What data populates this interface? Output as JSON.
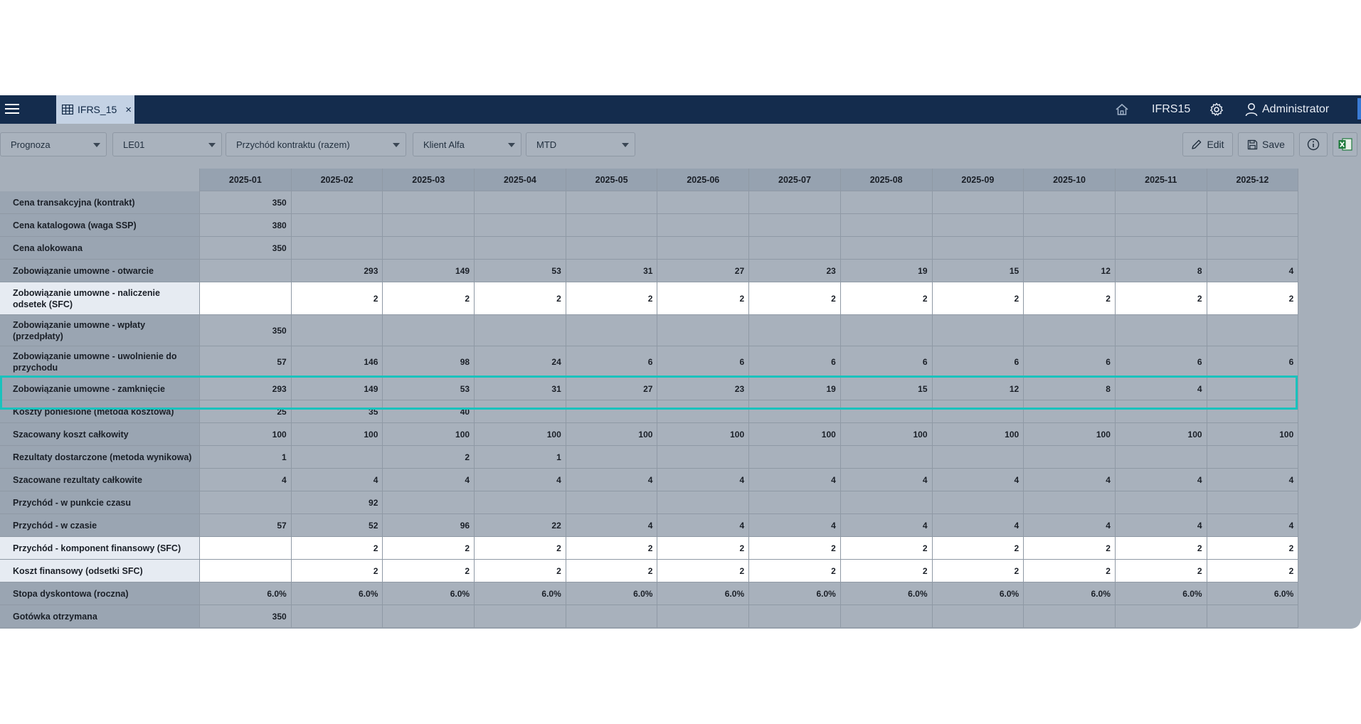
{
  "topbar": {
    "tab_label": "IFRS_15",
    "tab_close": "×",
    "home_icon": "home-icon",
    "module_label": "IFRS15",
    "user_label": "Administrator"
  },
  "filters": [
    {
      "value": "Prognoza"
    },
    {
      "value": "LE01"
    },
    {
      "value": "Przychód kontraktu (razem)"
    },
    {
      "value": "Klient Alfa"
    },
    {
      "value": "MTD"
    }
  ],
  "toolbar": {
    "edit_label": "Edit",
    "save_label": "Save"
  },
  "grid": {
    "columns": [
      "2025-01",
      "2025-02",
      "2025-03",
      "2025-04",
      "2025-05",
      "2025-06",
      "2025-07",
      "2025-08",
      "2025-09",
      "2025-10",
      "2025-11",
      "2025-12"
    ],
    "rows": [
      {
        "label": "Cena transakcyjna (kontrakt)",
        "values": [
          "350",
          "",
          "",
          "",
          "",
          "",
          "",
          "",
          "",
          "",
          "",
          ""
        ]
      },
      {
        "label": "Cena katalogowa (waga SSP)",
        "values": [
          "380",
          "",
          "",
          "",
          "",
          "",
          "",
          "",
          "",
          "",
          "",
          ""
        ]
      },
      {
        "label": "Cena alokowana",
        "values": [
          "350",
          "",
          "",
          "",
          "",
          "",
          "",
          "",
          "",
          "",
          "",
          ""
        ]
      },
      {
        "label": "Zobowiązanie umowne - otwarcie",
        "values": [
          "",
          "293",
          "149",
          "53",
          "31",
          "27",
          "23",
          "19",
          "15",
          "12",
          "8",
          "4"
        ]
      },
      {
        "label": "Zobowiązanie umowne - naliczenie odsetek (SFC)",
        "values": [
          "",
          "2",
          "2",
          "2",
          "2",
          "2",
          "2",
          "2",
          "2",
          "2",
          "2",
          "2"
        ]
      },
      {
        "label": "Zobowiązanie umowne - wpłaty (przedpłaty)",
        "values": [
          "350",
          "",
          "",
          "",
          "",
          "",
          "",
          "",
          "",
          "",
          "",
          ""
        ]
      },
      {
        "label": "Zobowiązanie umowne - uwolnienie do przychodu",
        "values": [
          "57",
          "146",
          "98",
          "24",
          "6",
          "6",
          "6",
          "6",
          "6",
          "6",
          "6",
          "6"
        ]
      },
      {
        "label": "Zobowiązanie umowne - zamknięcie",
        "values": [
          "293",
          "149",
          "53",
          "31",
          "27",
          "23",
          "19",
          "15",
          "12",
          "8",
          "4",
          ""
        ]
      },
      {
        "label": "Koszty poniesione (metoda kosztowa)",
        "values": [
          "25",
          "35",
          "40",
          "",
          "",
          "",
          "",
          "",
          "",
          "",
          "",
          ""
        ]
      },
      {
        "label": "Szacowany koszt całkowity",
        "values": [
          "100",
          "100",
          "100",
          "100",
          "100",
          "100",
          "100",
          "100",
          "100",
          "100",
          "100",
          "100"
        ]
      },
      {
        "label": "Rezultaty dostarczone (metoda wynikowa)",
        "values": [
          "1",
          "",
          "2",
          "1",
          "",
          "",
          "",
          "",
          "",
          "",
          "",
          ""
        ]
      },
      {
        "label": "Szacowane rezultaty całkowite",
        "values": [
          "4",
          "4",
          "4",
          "4",
          "4",
          "4",
          "4",
          "4",
          "4",
          "4",
          "4",
          "4"
        ]
      },
      {
        "label": "Przychód - w punkcie czasu",
        "values": [
          "",
          "92",
          "",
          "",
          "",
          "",
          "",
          "",
          "",
          "",
          "",
          ""
        ]
      },
      {
        "label": "Przychód - w czasie",
        "values": [
          "57",
          "52",
          "96",
          "22",
          "4",
          "4",
          "4",
          "4",
          "4",
          "4",
          "4",
          "4"
        ]
      },
      {
        "label": "Przychód - komponent finansowy (SFC)",
        "values": [
          "",
          "2",
          "2",
          "2",
          "2",
          "2",
          "2",
          "2",
          "2",
          "2",
          "2",
          "2"
        ]
      },
      {
        "label": "Koszt finansowy (odsetki SFC)",
        "values": [
          "",
          "2",
          "2",
          "2",
          "2",
          "2",
          "2",
          "2",
          "2",
          "2",
          "2",
          "2"
        ]
      },
      {
        "label": "Stopa dyskontowa (roczna)",
        "values": [
          "6.0%",
          "6.0%",
          "6.0%",
          "6.0%",
          "6.0%",
          "6.0%",
          "6.0%",
          "6.0%",
          "6.0%",
          "6.0%",
          "6.0%",
          "6.0%"
        ]
      },
      {
        "label": "Gotówka otrzymana",
        "values": [
          "350",
          "",
          "",
          "",
          "",
          "",
          "",
          "",
          "",
          "",
          "",
          ""
        ]
      }
    ]
  },
  "colors": {
    "topbar": "#142c4d",
    "highlight": "#19c2bd",
    "excel_green": "#1e7a3c"
  }
}
